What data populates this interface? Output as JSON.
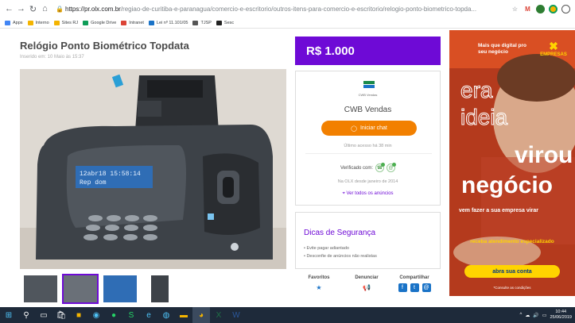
{
  "browser": {
    "url_host": "https://pr.olx.com.br",
    "url_path": "/regiao-de-curitiba-e-paranagua/comercio-e-escritorio/outros-itens-para-comercio-e-escritorio/relogio-ponto-biometrico-topda...",
    "back_icon": "back-arrow-icon",
    "forward_icon": "forward-arrow-icon",
    "reload_icon": "reload-icon",
    "home_icon": "home-icon"
  },
  "bookmarks": [
    {
      "label": "Apps",
      "color": "#4285f4"
    },
    {
      "label": "Interno",
      "color": "#f4b400"
    },
    {
      "label": "Sites RJ",
      "color": "#f4b400"
    },
    {
      "label": "Google Drive",
      "color": "#0f9d58"
    },
    {
      "label": "Intranet",
      "color": "#db4437"
    },
    {
      "label": "Lei nº 11.101/05",
      "color": "#1a73c7"
    },
    {
      "label": "TJSP",
      "color": "#555555"
    },
    {
      "label": "Sesc",
      "color": "#222222"
    }
  ],
  "listing": {
    "title": "Relógio Ponto Biométrico Topdata",
    "posted": "Inserido em: 10 Maio às 15:37",
    "price": "R$ 1.000",
    "device_display": "12abr18 15:58:14",
    "device_display_2": "Rep           dom"
  },
  "seller": {
    "logo_caption": "CWB Vendas",
    "name": "CWB Vendas",
    "chat_label": "Iniciar chat",
    "last_access": "Último acesso há 38 min",
    "verified_label": "Verificado com:",
    "since": "Na OLX desde janeiro de 2014",
    "all_ads_label": "Ver todos os anúncios"
  },
  "safety": {
    "title": "Dicas de Segurança",
    "tips": [
      "• Evite pagar adiantado",
      "• Desconfie de anúncios não realistas"
    ]
  },
  "actions": {
    "favorites": "Favoritos",
    "report": "Denunciar",
    "share": "Compartilhar"
  },
  "ad": {
    "headline": "Mais que digital pro seu negócio",
    "brand": "EMPRESAS",
    "era": "era",
    "ideia": "ideia",
    "virou": "virou",
    "negocio": "negócio",
    "sub": "vem fazer a sua empresa virar",
    "small": "receba atendimento especializado",
    "button": "abra sua conta",
    "foot": "*Consulte as condições"
  },
  "taskbar": {
    "time": "10:44",
    "date": "25/06/2019"
  },
  "colors": {
    "olx_purple": "#6e0ad6",
    "olx_orange": "#f28000",
    "bb_yellow": "#ffd400"
  }
}
